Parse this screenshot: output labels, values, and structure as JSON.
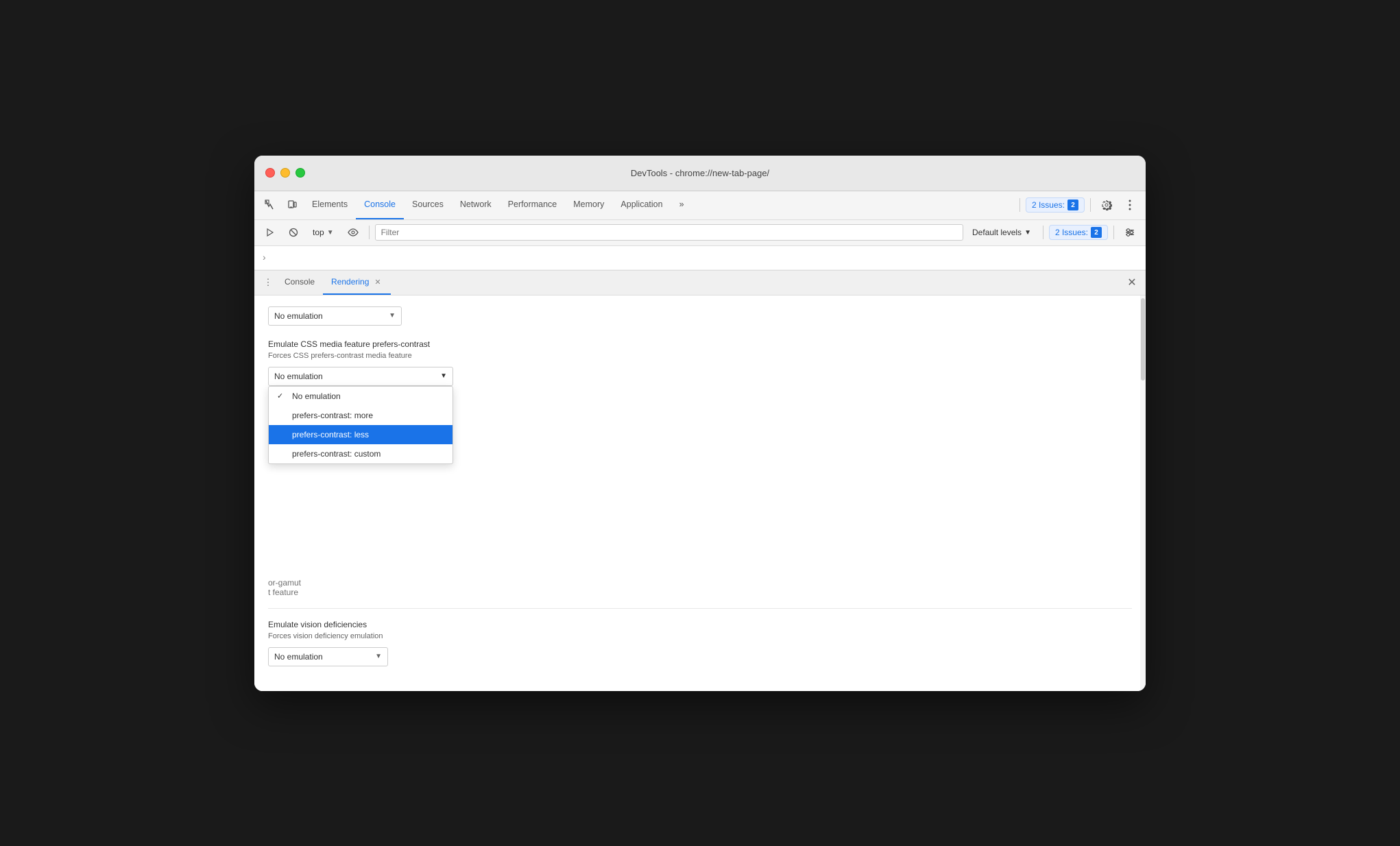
{
  "window": {
    "title": "DevTools - chrome://new-tab-page/"
  },
  "tabs": {
    "items": [
      {
        "label": "Elements",
        "active": false
      },
      {
        "label": "Console",
        "active": true
      },
      {
        "label": "Sources",
        "active": false
      },
      {
        "label": "Network",
        "active": false
      },
      {
        "label": "Performance",
        "active": false
      },
      {
        "label": "Memory",
        "active": false
      },
      {
        "label": "Application",
        "active": false
      }
    ],
    "more_label": "»"
  },
  "toolbar2": {
    "context_label": "top",
    "filter_placeholder": "Filter",
    "levels_label": "Default levels",
    "issues_label": "2 Issues:",
    "issues_count": "2"
  },
  "drawer": {
    "menu_icon": "⋮",
    "tabs": [
      {
        "label": "Console",
        "active": false,
        "closable": false
      },
      {
        "label": "Rendering",
        "active": true,
        "closable": true
      }
    ],
    "close_label": "✕"
  },
  "rendering": {
    "top_dropdown": {
      "value": "No emulation",
      "options": [
        "No emulation"
      ]
    },
    "prefers_contrast": {
      "label": "Emulate CSS media feature prefers-contrast",
      "sublabel": "Forces CSS prefers-contrast media feature",
      "dropdown_value": "No emulation",
      "options": [
        {
          "label": "No emulation",
          "checked": true,
          "selected": false
        },
        {
          "label": "prefers-contrast: more",
          "checked": false,
          "selected": false
        },
        {
          "label": "prefers-contrast: less",
          "checked": false,
          "selected": true
        },
        {
          "label": "prefers-contrast: custom",
          "checked": false,
          "selected": false
        }
      ]
    },
    "partial_label1": "or-gamut",
    "partial_label2": "t feature",
    "vision": {
      "label": "Emulate vision deficiencies",
      "sublabel": "Forces vision deficiency emulation",
      "dropdown_value": "No emulation"
    }
  },
  "colors": {
    "active_tab": "#1a73e8",
    "selected_option_bg": "#1a73e8",
    "selected_option_text": "#ffffff"
  }
}
